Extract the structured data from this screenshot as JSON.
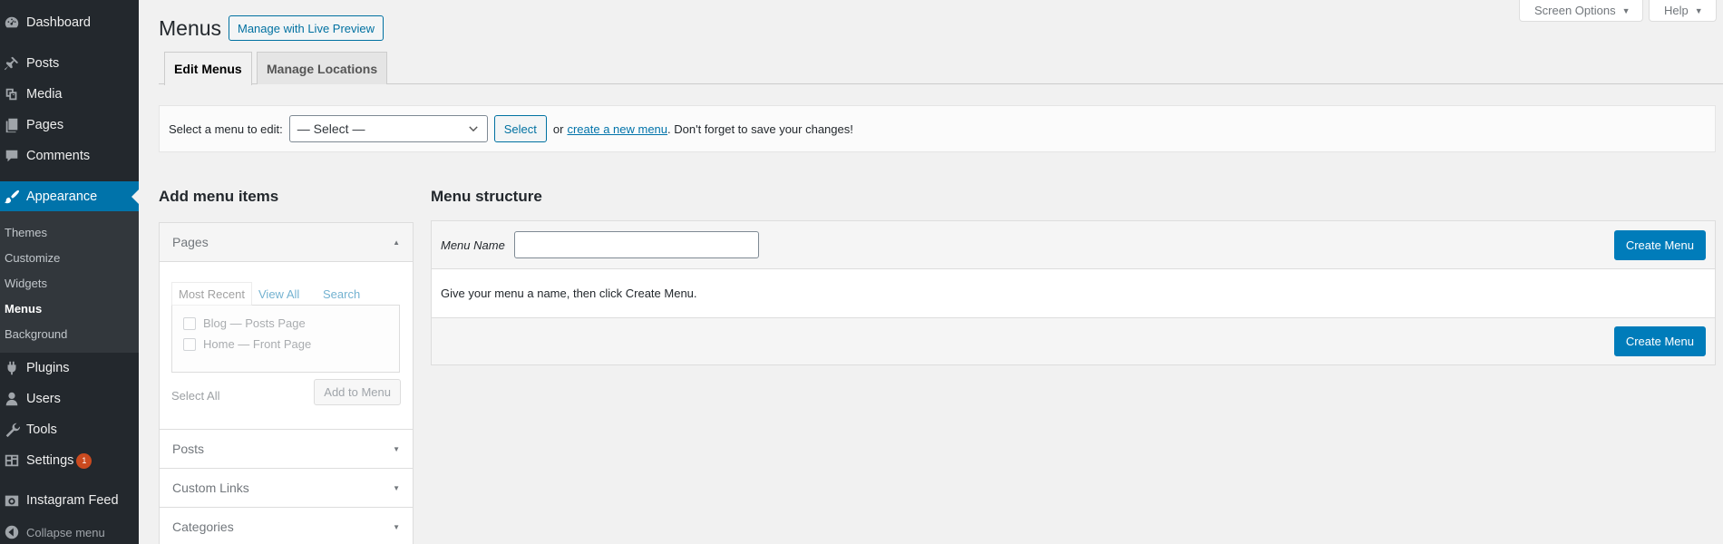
{
  "sidebar": {
    "items": [
      {
        "label": "Dashboard",
        "icon": "dashboard-icon"
      },
      {
        "label": "Posts",
        "icon": "pushpin-icon"
      },
      {
        "label": "Media",
        "icon": "media-icon"
      },
      {
        "label": "Pages",
        "icon": "pages-icon"
      },
      {
        "label": "Comments",
        "icon": "comment-icon"
      },
      {
        "label": "Appearance",
        "icon": "paintbrush-icon"
      },
      {
        "label": "Plugins",
        "icon": "plugin-icon"
      },
      {
        "label": "Users",
        "icon": "user-icon"
      },
      {
        "label": "Tools",
        "icon": "wrench-icon"
      },
      {
        "label": "Settings",
        "icon": "settings-icon",
        "badge": "1"
      },
      {
        "label": "Instagram Feed",
        "icon": "camera-icon"
      }
    ],
    "appearance_submenu": [
      "Themes",
      "Customize",
      "Widgets",
      "Menus",
      "Background"
    ],
    "collapse_label": "Collapse menu"
  },
  "header": {
    "screen_options": "Screen Options",
    "help": "Help",
    "title": "Menus",
    "live_preview": "Manage with Live Preview"
  },
  "tabs": {
    "edit_menus": "Edit Menus",
    "manage_locations": "Manage Locations"
  },
  "manage_bar": {
    "label": "Select a menu to edit:",
    "select_value": "— Select —",
    "select_button": "Select",
    "or": "or",
    "create_link": "create a new menu",
    "suffix": ". Don't forget to save your changes!"
  },
  "add_items": {
    "heading": "Add menu items",
    "pages_title": "Pages",
    "inner_tabs": [
      "Most Recent",
      "View All",
      "Search"
    ],
    "pages": [
      "Blog — Posts Page",
      "Home — Front Page"
    ],
    "select_all": "Select All",
    "add_button": "Add to Menu",
    "sections": [
      "Posts",
      "Custom Links",
      "Categories"
    ]
  },
  "structure": {
    "heading": "Menu structure",
    "name_label": "Menu Name",
    "name_value": "",
    "create_button": "Create Menu",
    "instructions": "Give your menu a name, then click Create Menu."
  },
  "colors": {
    "sidebar_bg": "#23282d",
    "accent": "#0073aa",
    "primary_button": "#007cba",
    "badge": "#ca4a1f"
  }
}
